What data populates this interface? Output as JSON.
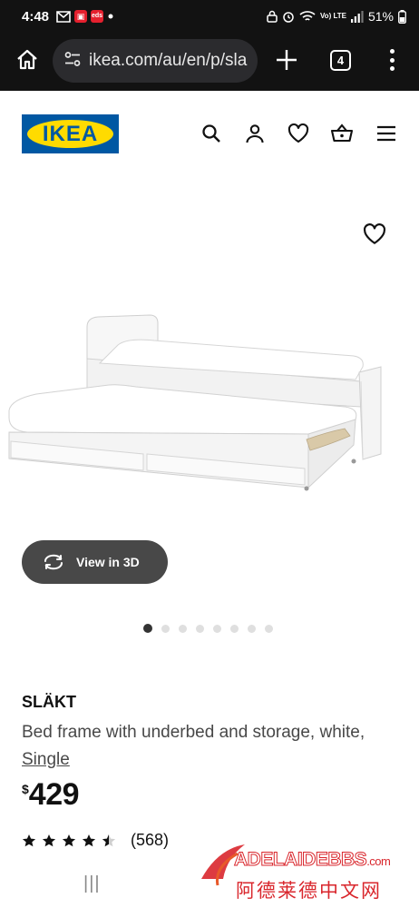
{
  "status_bar": {
    "time": "4:48",
    "battery": "51%",
    "network": "Vo) LTE",
    "left_icons": [
      "gmail-icon",
      "app-icon",
      "app-icon-2",
      "dot-icon"
    ],
    "right_icons": [
      "lock-icon",
      "alarm-icon",
      "wifi-icon",
      "signal-icon",
      "battery-icon"
    ]
  },
  "browser": {
    "url": "ikea.com/au/en/p/sla",
    "tab_count": "4"
  },
  "header": {
    "logo_text": "IKEA",
    "icons": [
      "search-icon",
      "account-icon",
      "heart-icon",
      "basket-icon",
      "menu-icon"
    ]
  },
  "product": {
    "name": "SLÄKT",
    "description": "Bed frame with underbed and storage, white,",
    "size": "Single",
    "currency": "$",
    "price": "429",
    "rating_value": 4.5,
    "rating_max": 5,
    "review_count": "(568)",
    "view_3d_label": "View in 3D",
    "image_count": 8,
    "active_image": 1
  },
  "bottom_nav": {
    "recent_apps": "|||"
  },
  "watermark": {
    "brand": "ADELAIDEBBS",
    "domain": ".com",
    "chinese": "阿德莱德中文网"
  },
  "colors": {
    "ikea_blue": "#0058a3",
    "ikea_yellow": "#ffdb00",
    "browser_dark": "#121212",
    "view3d_bg": "#484848"
  }
}
